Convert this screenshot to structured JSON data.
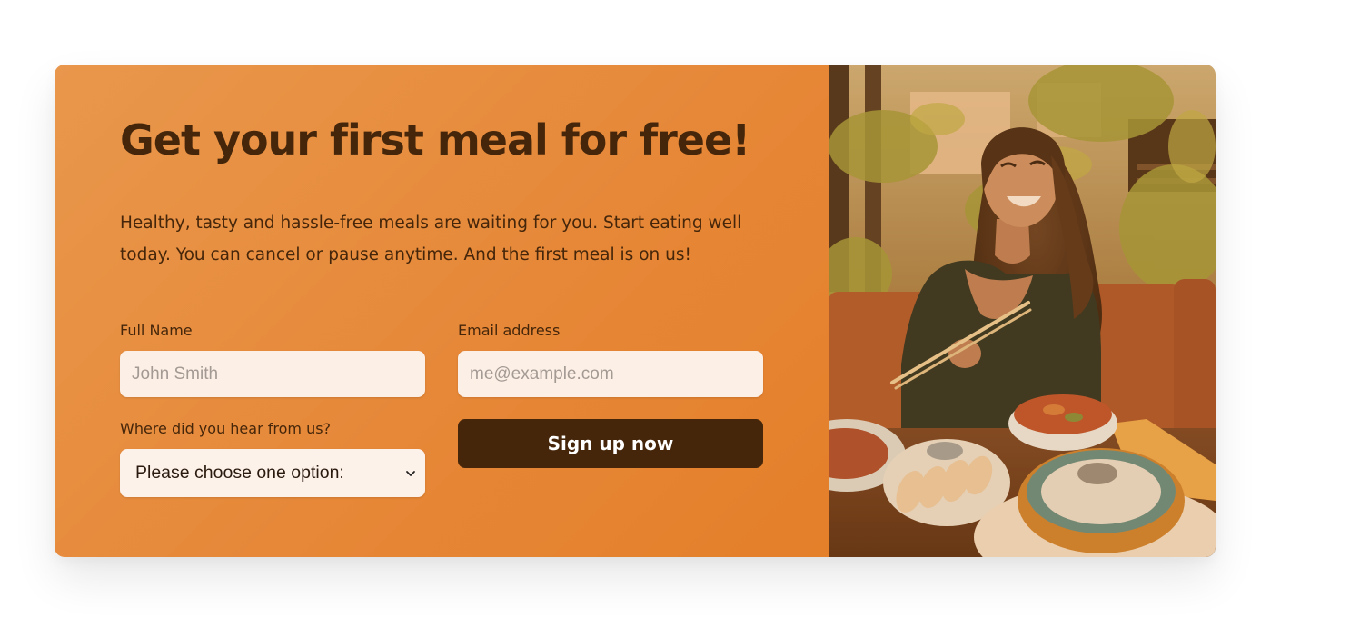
{
  "cta": {
    "heading": "Get your first meal for free!",
    "description": "Healthy, tasty and hassle-free meals are waiting for you. Start eating well today. You can cancel or pause anytime. And the first meal is on us!"
  },
  "form": {
    "full_name": {
      "label": "Full Name",
      "placeholder": "John Smith",
      "value": ""
    },
    "email": {
      "label": "Email address",
      "placeholder": "me@example.com",
      "value": ""
    },
    "source": {
      "label": "Where did you hear from us?",
      "selected": "Please choose one option:"
    },
    "submit_label": "Sign up now"
  },
  "image": {
    "icon": "photo-woman-eating-meal"
  },
  "colors": {
    "brand": "#e67e22",
    "dark_text": "#45260a",
    "input_bg": "#fdf2e9",
    "button_bg": "#45260a"
  }
}
